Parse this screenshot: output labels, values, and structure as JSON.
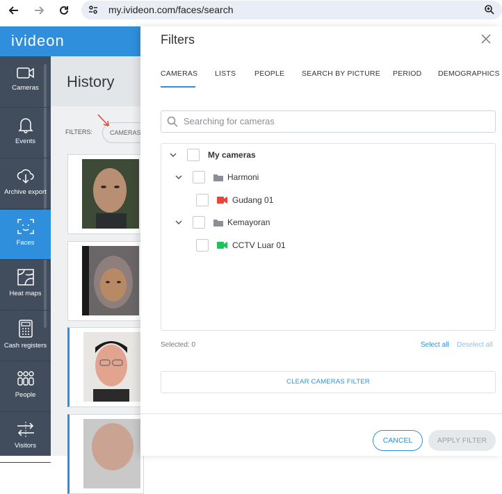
{
  "browser": {
    "url": "my.ivideon.com/faces/search",
    "back_icon": "back-arrow-icon",
    "forward_icon": "forward-arrow-icon",
    "reload_icon": "reload-icon",
    "zoom_icon": "zoom-icon"
  },
  "app": {
    "brand": "ivideon",
    "accent_color": "#2f8fdc",
    "sidebar": {
      "items": [
        {
          "label": "Cameras",
          "icon": "camera-icon"
        },
        {
          "label": "Events",
          "icon": "bell-icon"
        },
        {
          "label": "Archive export",
          "icon": "cloud-download-icon"
        },
        {
          "label": "Faces",
          "icon": "face-scan-icon",
          "active": true
        },
        {
          "label": "Heat maps",
          "icon": "heatmap-icon"
        },
        {
          "label": "Cash registers",
          "icon": "cash-register-icon"
        },
        {
          "label": "People",
          "icon": "people-icon"
        },
        {
          "label": "Visitors",
          "icon": "visitors-icon"
        }
      ]
    },
    "history": {
      "title": "History",
      "filters_label": "FILTERS:",
      "filter_chip": "CAMERAS"
    }
  },
  "modal": {
    "title": "Filters",
    "tabs": [
      "CAMERAS",
      "LISTS",
      "PEOPLE",
      "SEARCH BY PICTURE",
      "PERIOD",
      "DEMOGRAPHICS"
    ],
    "active_tab": "CAMERAS",
    "search_placeholder": "Searching for cameras",
    "tree": {
      "root": "My cameras",
      "groups": [
        {
          "name": "Harmoni",
          "cameras": [
            {
              "name": "Gudang 01",
              "status_color": "#e8453c"
            }
          ]
        },
        {
          "name": "Kemayoran",
          "cameras": [
            {
              "name": "CCTV Luar 01",
              "status_color": "#1fc15e"
            }
          ]
        }
      ]
    },
    "selected_text": "Selected: 0",
    "select_all": "Select all",
    "deselect_all": "Deselect all",
    "clear_button": "CLEAR CAMERAS FILTER",
    "cancel_button": "CANCEL",
    "apply_button": "APPLY FILTER"
  }
}
